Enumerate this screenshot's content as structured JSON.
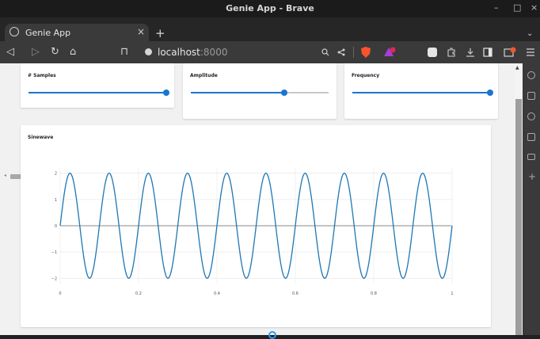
{
  "window": {
    "title": "Genie App - Brave",
    "controls": [
      "–",
      "□",
      "×"
    ]
  },
  "tab": {
    "title": "Genie App",
    "close": "×",
    "new_tab": "+",
    "menu": "⌄"
  },
  "nav": {
    "back": "◁",
    "forward": "▷",
    "reload": "↻",
    "home": "⌂",
    "bookmark": "⊓"
  },
  "address": {
    "host": "localhost",
    "port": ":8000"
  },
  "toolbar_icons": [
    "zoom-icon",
    "share-icon",
    "brave-shields-icon",
    "brave-rewards-icon",
    "extension-icon",
    "puzzle-icon",
    "download-icon",
    "sidebar-icon",
    "wallet-icon",
    "menu-icon"
  ],
  "controls": {
    "samples": {
      "label": "# Samples",
      "value": 1.0
    },
    "amplitude": {
      "label": "Amplitude",
      "value": 0.68
    },
    "frequency": {
      "label": "Frequency",
      "value": 1.0
    }
  },
  "plot_card": {
    "title": "Sinewave"
  },
  "colors": {
    "accent": "#1976d2",
    "trace": "#1f77b4"
  },
  "chart_data": {
    "type": "line",
    "title": "",
    "xlabel": "",
    "ylabel": "",
    "xlim": [
      0,
      1
    ],
    "ylim": [
      -2.2,
      2.2
    ],
    "xticks": [
      "0",
      "0.2",
      "0.4",
      "0.6",
      "0.8",
      "1"
    ],
    "yticks": [
      "2",
      "1",
      "0",
      "−1",
      "−2"
    ],
    "series": [
      {
        "amplitude": 2,
        "frequency": 10,
        "x_start": 0,
        "x_end": 1
      }
    ],
    "grid": true
  }
}
